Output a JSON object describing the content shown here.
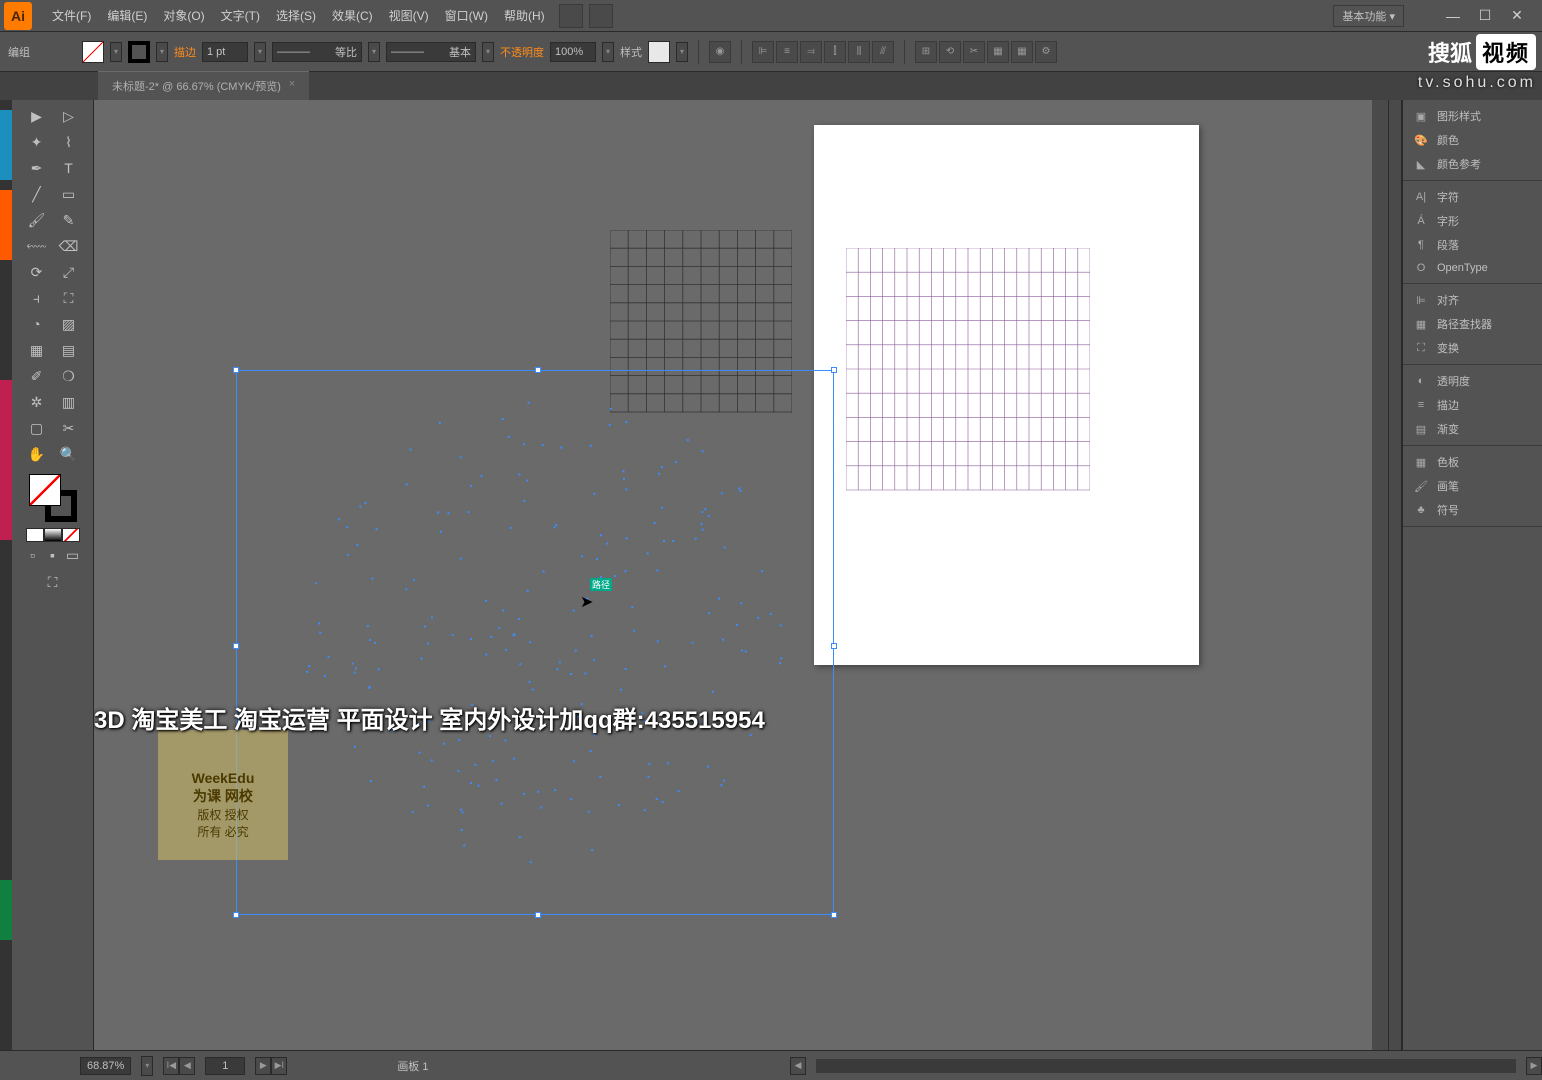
{
  "menu": [
    "文件(F)",
    "编辑(E)",
    "对象(O)",
    "文字(T)",
    "选择(S)",
    "效果(C)",
    "视图(V)",
    "窗口(W)",
    "帮助(H)"
  ],
  "workspace": "基本功能",
  "control": {
    "left_label": "编组",
    "stroke_label": "描边",
    "stroke_weight": "1 pt",
    "profile": "等比",
    "brush": "基本",
    "opacity_label": "不透明度",
    "opacity_value": "100%",
    "style_label": "样式"
  },
  "tab": {
    "name": "未标题-2* @ 66.67% (CMYK/预览)"
  },
  "panels": [
    [
      "图形样式",
      "颜色",
      "颜色参考"
    ],
    [
      "字符",
      "字形",
      "段落",
      "OpenType"
    ],
    [
      "对齐",
      "路径查找器",
      "变换"
    ],
    [
      "透明度",
      "描边",
      "渐变"
    ],
    [
      "色板",
      "画笔",
      "符号"
    ]
  ],
  "status": {
    "zoom": "68.87%",
    "artboard_nav": "1",
    "artboard_label": "画板 1"
  },
  "overlay": "3D 淘宝美工 淘宝运营 平面设计 室内外设计加qq群:435515954",
  "weekedu": {
    "line1": "WeekEdu",
    "line2": "为课 网校",
    "line3": "版权   授权",
    "line4": "所有   必究"
  },
  "sohu": {
    "search": "搜狐",
    "video": "视频",
    "url": "tv.sohu.com"
  },
  "icons": {
    "globe": "◉",
    "align_l": "⊫",
    "align_c": "≡",
    "align_r": "⫤",
    "dist1": "⫿",
    "dist2": "⫼",
    "dist3": "⫻",
    "guide": "⊞",
    "transform": "⟲",
    "cut": "✂",
    "setup": "▦",
    "pref": "⚙"
  }
}
